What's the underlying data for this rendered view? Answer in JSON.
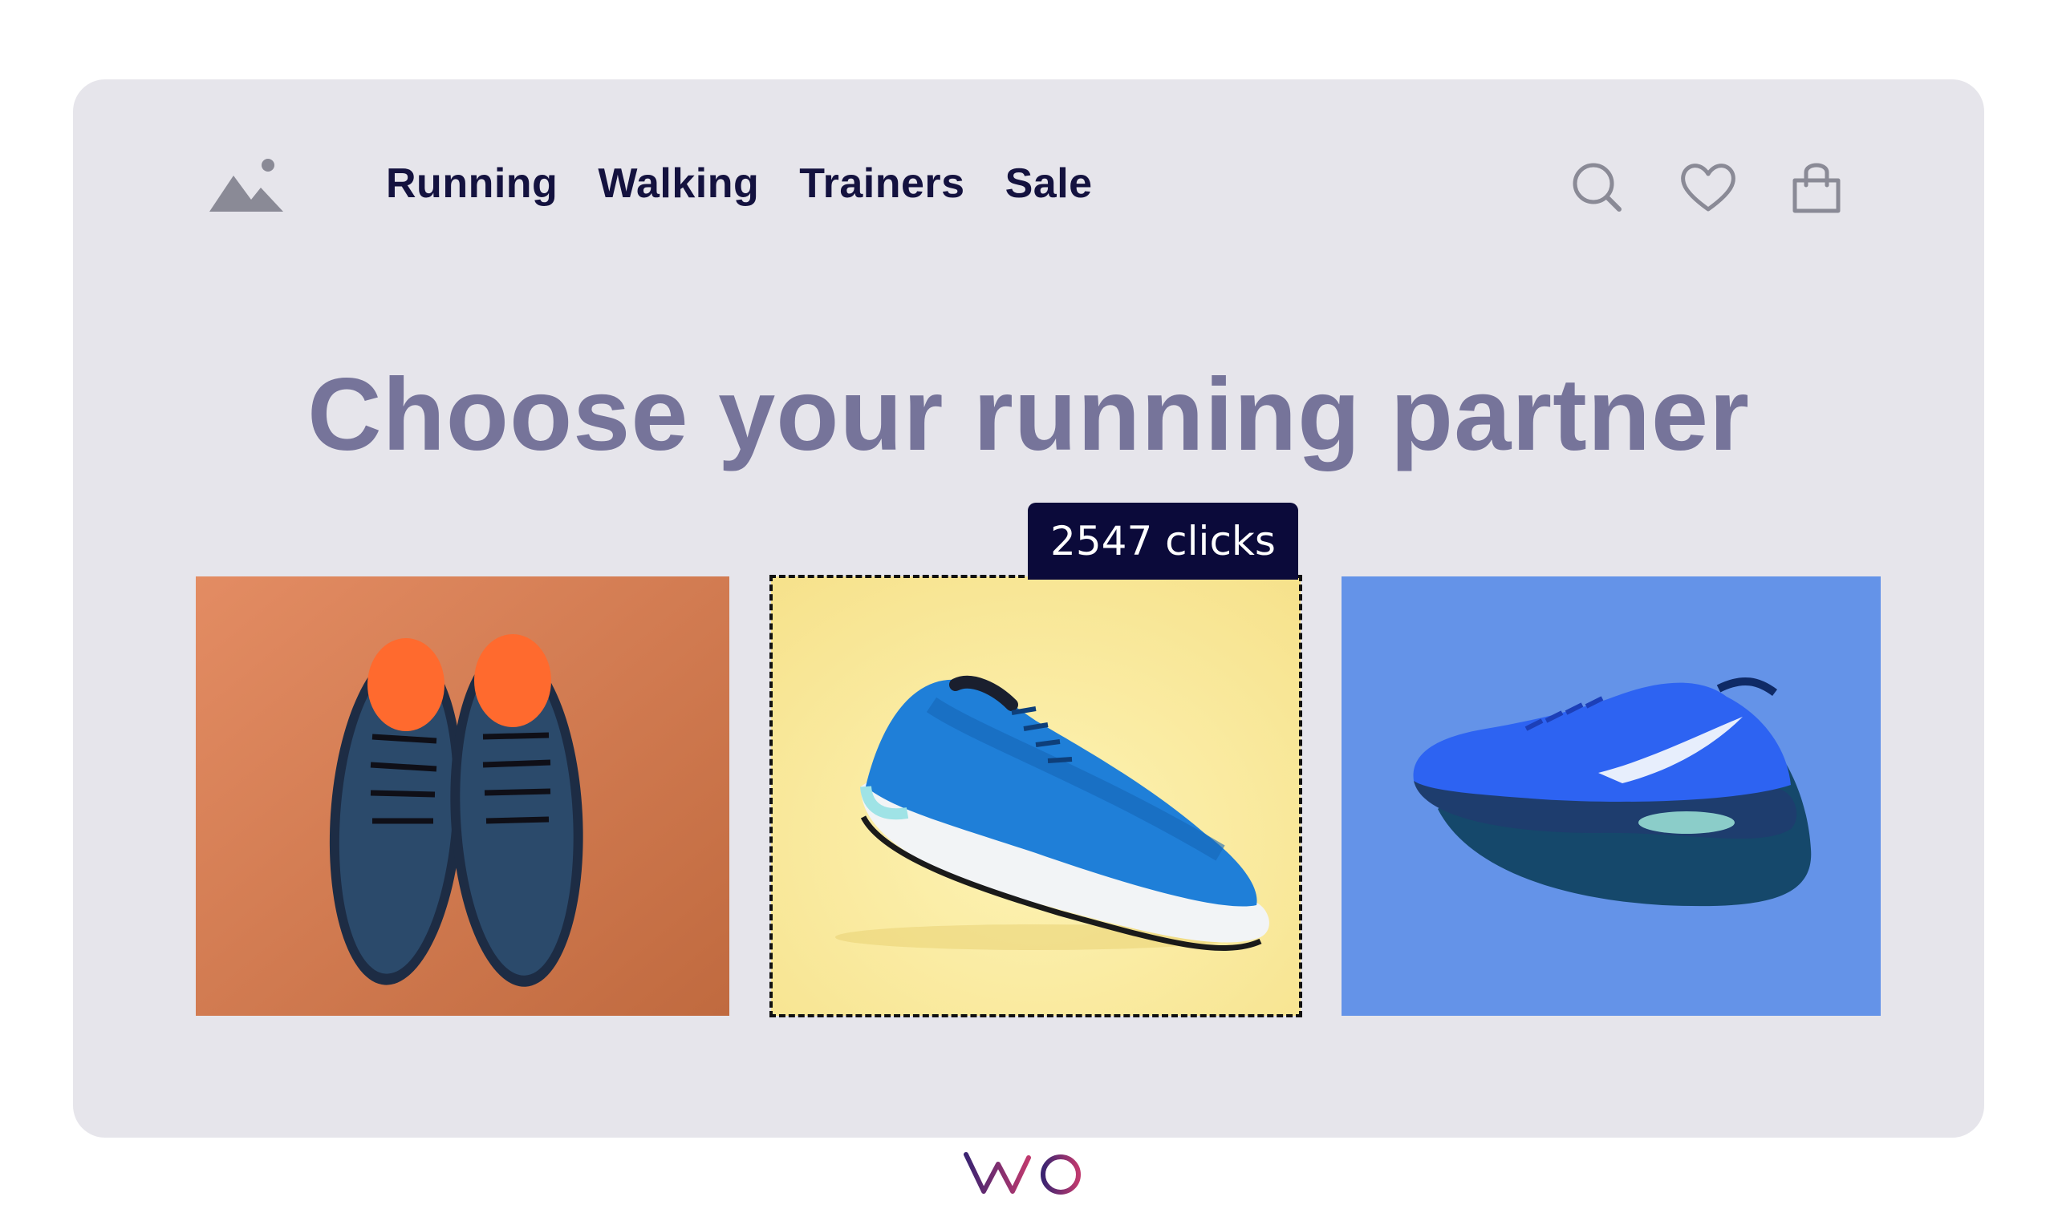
{
  "nav": {
    "items": [
      {
        "label": "Running"
      },
      {
        "label": "Walking"
      },
      {
        "label": "Trainers"
      },
      {
        "label": "Sale"
      }
    ]
  },
  "header": {
    "icons": [
      "search-icon",
      "heart-icon",
      "shopping-bag-icon"
    ]
  },
  "hero": {
    "title": "Choose your running partner"
  },
  "tooltip": {
    "text": "2547 clicks"
  },
  "products": [
    {
      "name": "orange-background-shoes",
      "bg": "#d9855b"
    },
    {
      "name": "yellow-background-shoe",
      "bg": "#f8e89a"
    },
    {
      "name": "blue-background-shoe",
      "bg": "#6493e8"
    }
  ],
  "brand": {
    "logo": "VWO"
  },
  "colors": {
    "card_bg": "#e6e5eb",
    "nav_text": "#14123f",
    "headline": "#76749a",
    "tooltip_bg": "#0b0a3a",
    "icons": "#8a8a96"
  }
}
